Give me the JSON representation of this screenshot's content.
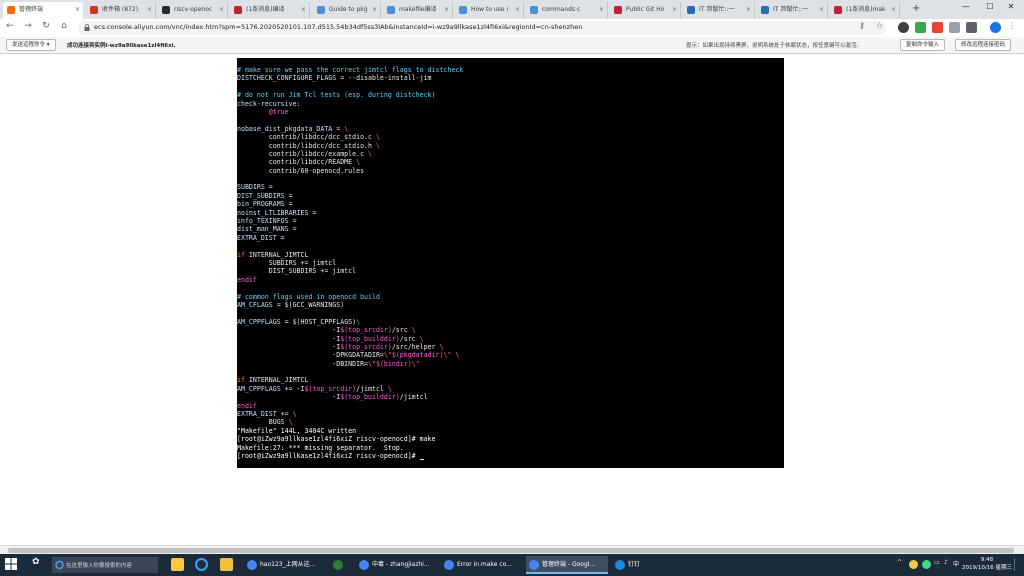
{
  "browser": {
    "tabs": [
      {
        "label": "管理终端",
        "color": "#ff6a00",
        "active": true
      },
      {
        "label": "收件箱 (872)",
        "color": "#d93025"
      },
      {
        "label": "riscv-openoc",
        "color": "#24292e"
      },
      {
        "label": "(1条消息)编译",
        "color": "#c32136"
      },
      {
        "label": "Guide to pkg",
        "color": "#4a90d9"
      },
      {
        "label": "makefile编译",
        "color": "#4a90d9"
      },
      {
        "label": "How to use i",
        "color": "#4a90d9"
      },
      {
        "label": "commands c",
        "color": "#4a90d9"
      },
      {
        "label": "Public Git Ho",
        "color": "#c32136"
      },
      {
        "label": "IT 邦幫忙::一",
        "color": "#2b6cb0"
      },
      {
        "label": "IT 邦幫忙::一",
        "color": "#2b6cb0"
      },
      {
        "label": "(1条消息)mak",
        "color": "#c32136"
      }
    ],
    "new_tab": "+",
    "window_controls": {
      "minimize": "—",
      "maximize": "☐",
      "close": "✕"
    },
    "nav": {
      "back": "←",
      "forward": "→",
      "reload": "↻",
      "home": "⌂"
    },
    "url": "ecs.console.aliyun.com/vnc/index.htm?spm=5176.2020520101.107.d515.54b34df5ss3lAb&instanceId=i-wz9a9llkase1zl4fi6xi&regionId=cn-shenzhen"
  },
  "console_toolbar": {
    "send_remote_cmd": "发送远程命令 ▾",
    "status": "成功连接到实例i-wz9a9llkase1zl4fi6xi.",
    "hint": "提示：如果出现持续黑屏，说明系统处于休眠状态，按任意键可以激活。",
    "copy_cmd": "复制命令输入",
    "modify_pwd": "修改远程连接密码"
  },
  "terminal": {
    "lines": [
      [
        {
          "t": "# make sure we pass the correct jimtcl flags to distcheck",
          "c": "c-comment"
        }
      ],
      [
        {
          "t": "DISTCHECK_CONFIGURE_FLAGS",
          "c": "c-var"
        },
        {
          "t": " = --disable-install-jim",
          "c": "c-plain"
        }
      ],
      [
        {
          "t": "",
          "c": "c-plain"
        }
      ],
      [
        {
          "t": "# do not run Jim Tcl tests (esp. during distcheck)",
          "c": "c-comment"
        }
      ],
      [
        {
          "t": "check-recursive:",
          "c": "c-var"
        }
      ],
      [
        {
          "t": "        ",
          "c": "c-plain"
        },
        {
          "t": "@true",
          "c": "c-kw"
        }
      ],
      [
        {
          "t": "",
          "c": "c-plain"
        }
      ],
      [
        {
          "t": "nobase_dist_pkgdata_DATA",
          "c": "c-var"
        },
        {
          "t": " = ",
          "c": "c-plain"
        },
        {
          "t": "\\",
          "c": "c-str"
        }
      ],
      [
        {
          "t": "        contrib/libdcc/dcc_stdio.c ",
          "c": "c-plain"
        },
        {
          "t": "\\",
          "c": "c-str"
        }
      ],
      [
        {
          "t": "        contrib/libdcc/dcc_stdio.h ",
          "c": "c-plain"
        },
        {
          "t": "\\",
          "c": "c-str"
        }
      ],
      [
        {
          "t": "        contrib/libdcc/example.c ",
          "c": "c-plain"
        },
        {
          "t": "\\",
          "c": "c-str"
        }
      ],
      [
        {
          "t": "        contrib/libdcc/README ",
          "c": "c-plain"
        },
        {
          "t": "\\",
          "c": "c-str"
        }
      ],
      [
        {
          "t": "        contrib/60-openocd.rules",
          "c": "c-plain"
        }
      ],
      [
        {
          "t": "",
          "c": "c-plain"
        }
      ],
      [
        {
          "t": "SUBDIRS",
          "c": "c-var"
        },
        {
          "t": " =",
          "c": "c-plain"
        }
      ],
      [
        {
          "t": "DIST_SUBDIRS",
          "c": "c-var"
        },
        {
          "t": " =",
          "c": "c-plain"
        }
      ],
      [
        {
          "t": "bin_PROGRAMS",
          "c": "c-var"
        },
        {
          "t": " =",
          "c": "c-plain"
        }
      ],
      [
        {
          "t": "noinst_LTLIBRARIES",
          "c": "c-var"
        },
        {
          "t": " =",
          "c": "c-plain"
        }
      ],
      [
        {
          "t": "info_TEXINFOS",
          "c": "c-var"
        },
        {
          "t": " =",
          "c": "c-plain"
        }
      ],
      [
        {
          "t": "dist_man_MANS",
          "c": "c-var"
        },
        {
          "t": " =",
          "c": "c-plain"
        }
      ],
      [
        {
          "t": "EXTRA_DIST",
          "c": "c-var"
        },
        {
          "t": " =",
          "c": "c-plain"
        }
      ],
      [
        {
          "t": "",
          "c": "c-plain"
        }
      ],
      [
        {
          "t": "if",
          "c": "c-orange"
        },
        {
          "t": " INTERNAL_JIMTCL",
          "c": "c-plain"
        }
      ],
      [
        {
          "t": "        SUBDIRS += jimtcl",
          "c": "c-plain"
        }
      ],
      [
        {
          "t": "        DIST_SUBDIRS += jimtcl",
          "c": "c-plain"
        }
      ],
      [
        {
          "t": "endif",
          "c": "c-kw"
        }
      ],
      [
        {
          "t": "",
          "c": "c-plain"
        }
      ],
      [
        {
          "t": "# common flags used in openocd build",
          "c": "c-comment"
        }
      ],
      [
        {
          "t": "AM_CFLAGS",
          "c": "c-var"
        },
        {
          "t": " = $(GCC_WARNINGS)",
          "c": "c-plain"
        }
      ],
      [
        {
          "t": "",
          "c": "c-plain"
        }
      ],
      [
        {
          "t": "AM_CPPFLAGS",
          "c": "c-var"
        },
        {
          "t": " = $(HOST_CPPFLAGS)",
          "c": "c-plain"
        },
        {
          "t": "\\",
          "c": "c-str"
        }
      ],
      [
        {
          "t": "                        -I",
          "c": "c-plain"
        },
        {
          "t": "$(top_srcdir)",
          "c": "c-kw"
        },
        {
          "t": "/src ",
          "c": "c-plain"
        },
        {
          "t": "\\",
          "c": "c-str"
        }
      ],
      [
        {
          "t": "                        -I",
          "c": "c-plain"
        },
        {
          "t": "$(top_builddir)",
          "c": "c-kw"
        },
        {
          "t": "/src ",
          "c": "c-plain"
        },
        {
          "t": "\\",
          "c": "c-str"
        }
      ],
      [
        {
          "t": "                        -I",
          "c": "c-plain"
        },
        {
          "t": "$(top_srcdir)",
          "c": "c-kw"
        },
        {
          "t": "/src/helper ",
          "c": "c-plain"
        },
        {
          "t": "\\",
          "c": "c-str"
        }
      ],
      [
        {
          "t": "                        -DPKGDATADIR=",
          "c": "c-plain"
        },
        {
          "t": "\\\"",
          "c": "c-str"
        },
        {
          "t": "$(pkgdatadir)",
          "c": "c-kw"
        },
        {
          "t": "\\\" ",
          "c": "c-str"
        },
        {
          "t": "\\",
          "c": "c-str"
        }
      ],
      [
        {
          "t": "                        -DBINDIR=",
          "c": "c-plain"
        },
        {
          "t": "\\\"",
          "c": "c-str"
        },
        {
          "t": "$(bindir)",
          "c": "c-kw"
        },
        {
          "t": "\\\"",
          "c": "c-str"
        }
      ],
      [
        {
          "t": "",
          "c": "c-plain"
        }
      ],
      [
        {
          "t": "if",
          "c": "c-orange"
        },
        {
          "t": " INTERNAL_JIMTCL",
          "c": "c-plain"
        }
      ],
      [
        {
          "t": "AM_CPPFLAGS",
          "c": "c-var"
        },
        {
          "t": " += -I",
          "c": "c-plain"
        },
        {
          "t": "$(top_srcdir)",
          "c": "c-kw"
        },
        {
          "t": "/jimtcl ",
          "c": "c-plain"
        },
        {
          "t": "\\",
          "c": "c-str"
        }
      ],
      [
        {
          "t": "                        -I",
          "c": "c-plain"
        },
        {
          "t": "$(top_builddir)",
          "c": "c-kw"
        },
        {
          "t": "/jimtcl",
          "c": "c-plain"
        }
      ],
      [
        {
          "t": "endif",
          "c": "c-kw"
        }
      ],
      [
        {
          "t": "EXTRA_DIST",
          "c": "c-var"
        },
        {
          "t": " += ",
          "c": "c-plain"
        },
        {
          "t": "\\",
          "c": "c-str"
        }
      ],
      [
        {
          "t": "        BUGS ",
          "c": "c-plain"
        },
        {
          "t": "\\",
          "c": "c-str"
        }
      ],
      [
        {
          "t": "\"Makefile\" 144L, 3404C written",
          "c": "c-white"
        }
      ],
      [
        {
          "t": "[root@iZwz9a9llkase1zl4fi6xiZ riscv-openocd]# make",
          "c": "c-white"
        }
      ],
      [
        {
          "t": "Makefile:27: *** missing separator.  Stop.",
          "c": "c-white"
        }
      ],
      [
        {
          "t": "[root@iZwz9a9llkase1zl4fi6xiZ riscv-openocd]# ",
          "c": "c-white"
        }
      ]
    ]
  },
  "taskbar": {
    "search_placeholder": "在这里输入你要搜索的内容",
    "apps": [
      {
        "label": "hao123_上网从这...",
        "color": "#4285f4"
      },
      {
        "label": "",
        "color": "#2e7d32"
      },
      {
        "label": "中毒 - zhangjiazhi...",
        "color": "#4285f4"
      },
      {
        "label": "Error in make co...",
        "color": "#4285f4"
      },
      {
        "label": "管理终端 - Googl...",
        "color": "#4285f4",
        "active": true
      },
      {
        "label": "钉钉",
        "color": "#1e88e5"
      }
    ],
    "tray": {
      "chevron": "^",
      "ime": "中"
    },
    "time": "9:48",
    "date": "2019/10/16 星期三"
  }
}
